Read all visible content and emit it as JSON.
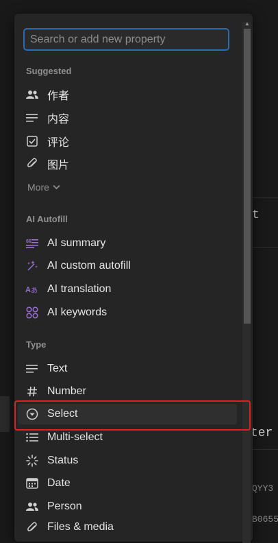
{
  "search": {
    "placeholder": "Search or add new property"
  },
  "sections": {
    "suggested": "Suggested",
    "ai_autofill": "AI Autofill",
    "type": "Type"
  },
  "suggested_items": [
    {
      "label": "作者",
      "icon": "people-icon"
    },
    {
      "label": "内容",
      "icon": "text-lines-icon"
    },
    {
      "label": "评论",
      "icon": "checkbox-icon"
    },
    {
      "label": "图片",
      "icon": "paperclip-icon"
    }
  ],
  "more_label": "More",
  "ai_items": [
    {
      "label": "AI summary",
      "icon": "ai-summary-icon"
    },
    {
      "label": "AI custom autofill",
      "icon": "sparkle-icon"
    },
    {
      "label": "AI translation",
      "icon": "translation-icon"
    },
    {
      "label": "AI keywords",
      "icon": "keywords-icon"
    }
  ],
  "type_items": [
    {
      "label": "Text",
      "icon": "text-lines-icon"
    },
    {
      "label": "Number",
      "icon": "hash-icon"
    },
    {
      "label": "Select",
      "icon": "select-circle-icon",
      "selected": true
    },
    {
      "label": "Multi-select",
      "icon": "list-icon"
    },
    {
      "label": "Status",
      "icon": "status-icon"
    },
    {
      "label": "Date",
      "icon": "calendar-icon"
    },
    {
      "label": "Person",
      "icon": "people-icon"
    },
    {
      "label": "Files & media",
      "icon": "paperclip-icon"
    }
  ],
  "background_text": {
    "ter": "ter",
    "code1": "QYY3",
    "code2": "B0655"
  },
  "colors": {
    "accent_ai": "#9a6fd6",
    "focus_border": "#2a6bb5",
    "highlight": "#e02020"
  }
}
